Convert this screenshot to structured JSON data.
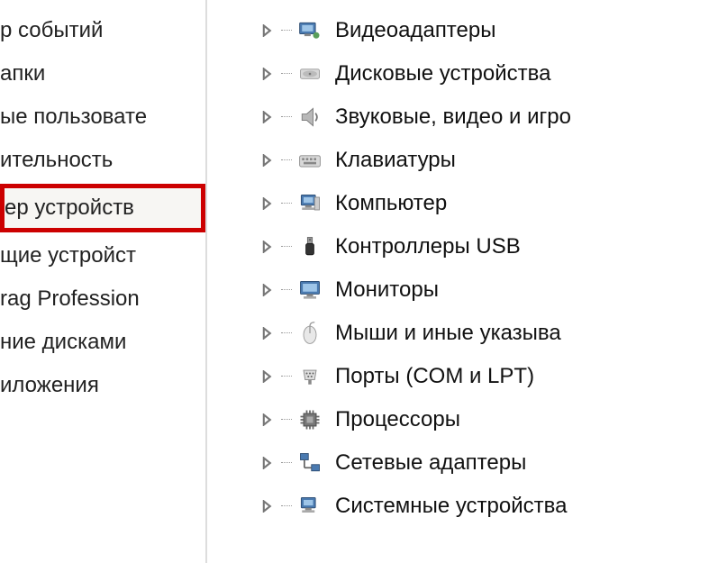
{
  "left_pane": {
    "items": [
      {
        "label": "р событий",
        "highlighted": false
      },
      {
        "label": "апки",
        "highlighted": false
      },
      {
        "label": "ые пользовате",
        "highlighted": false
      },
      {
        "label": "ительность",
        "highlighted": false
      },
      {
        "label": "ер устройств",
        "highlighted": true
      },
      {
        "label": "щие устройст",
        "highlighted": false
      },
      {
        "label": "rag Profession",
        "highlighted": false
      },
      {
        "label": "ние дисками",
        "highlighted": false
      },
      {
        "label": "иложения",
        "highlighted": false
      }
    ]
  },
  "device_tree": {
    "items": [
      {
        "icon": "display-adapter-icon",
        "label": "Видеоадаптеры"
      },
      {
        "icon": "disk-drive-icon",
        "label": "Дисковые устройства"
      },
      {
        "icon": "sound-icon",
        "label": "Звуковые, видео и игро"
      },
      {
        "icon": "keyboard-icon",
        "label": "Клавиатуры"
      },
      {
        "icon": "computer-icon",
        "label": "Компьютер"
      },
      {
        "icon": "usb-icon",
        "label": "Контроллеры USB"
      },
      {
        "icon": "monitor-icon",
        "label": "Мониторы"
      },
      {
        "icon": "mouse-icon",
        "label": "Мыши и иные указыва"
      },
      {
        "icon": "port-icon",
        "label": "Порты (COM и LPT)"
      },
      {
        "icon": "processor-icon",
        "label": "Процессоры"
      },
      {
        "icon": "network-icon",
        "label": "Сетевые адаптеры"
      },
      {
        "icon": "system-device-icon",
        "label": "Системные устройства"
      }
    ]
  }
}
